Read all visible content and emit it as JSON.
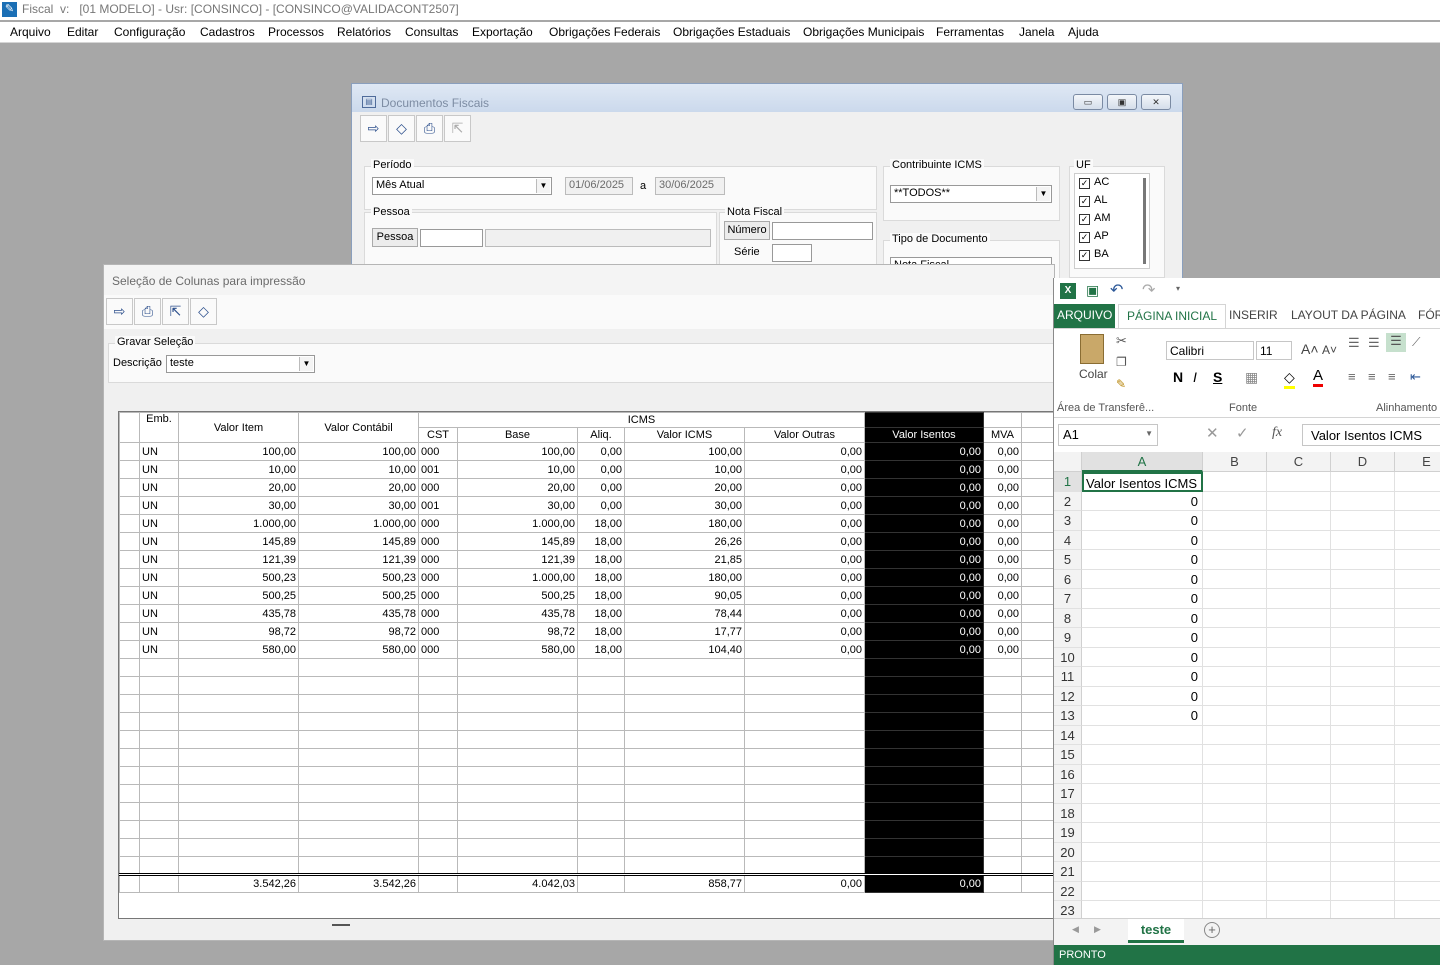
{
  "app": {
    "title": "Fiscal  v:   [01 MODELO] - Usr: [CONSINCO] - [CONSINCO@VALIDACONT2507]",
    "menu": [
      "Arquivo",
      "Editar",
      "Configuração",
      "Cadastros",
      "Processos",
      "Relatórios",
      "Consultas",
      "Exportação",
      "Obrigações Federais",
      "Obrigações Estaduais",
      "Obrigações Municipais",
      "Ferramentas",
      "Janela",
      "Ajuda"
    ]
  },
  "docwin": {
    "title": "Documentos Fiscais",
    "periodo_label": "Período",
    "periodo_value": "Mês Atual",
    "date_from": "01/06/2025",
    "date_sep": "a",
    "date_to": "30/06/2025",
    "contribuinte_label": "Contribuinte ICMS",
    "contribuinte_value": "**TODOS**",
    "uf_label": "UF",
    "uf_items": [
      "AC",
      "AL",
      "AM",
      "AP",
      "BA"
    ],
    "pessoa_label": "Pessoa",
    "pessoa_button": "Pessoa",
    "nota_label": "Nota Fiscal",
    "numero_label": "Número",
    "serie_label": "Série",
    "tipo_label": "Tipo de Documento",
    "tipo_value": "Nota Fiscal"
  },
  "selwin": {
    "title": "Seleção de Colunas para impressão",
    "gravar_label": "Gravar Seleção",
    "descricao_label": "Descrição",
    "descricao_value": "teste",
    "headers": {
      "emb": "Emb.",
      "valor_item": "Valor Item",
      "valor_contabil": "Valor Contábil",
      "icms": "ICMS",
      "cst": "CST",
      "base": "Base",
      "aliq": "Aliq.",
      "valor_icms": "Valor ICMS",
      "valor_outras": "Valor Outras",
      "valor_isentos": "Valor Isentos",
      "mva": "MVA"
    },
    "rows": [
      [
        "UN",
        "100,00",
        "100,00",
        "000",
        "100,00",
        "0,00",
        "100,00",
        "0,00",
        "0,00",
        "0,00"
      ],
      [
        "UN",
        "10,00",
        "10,00",
        "001",
        "10,00",
        "0,00",
        "10,00",
        "0,00",
        "0,00",
        "0,00"
      ],
      [
        "UN",
        "20,00",
        "20,00",
        "000",
        "20,00",
        "0,00",
        "20,00",
        "0,00",
        "0,00",
        "0,00"
      ],
      [
        "UN",
        "30,00",
        "30,00",
        "001",
        "30,00",
        "0,00",
        "30,00",
        "0,00",
        "0,00",
        "0,00"
      ],
      [
        "UN",
        "1.000,00",
        "1.000,00",
        "000",
        "1.000,00",
        "18,00",
        "180,00",
        "0,00",
        "0,00",
        "0,00"
      ],
      [
        "UN",
        "145,89",
        "145,89",
        "000",
        "145,89",
        "18,00",
        "26,26",
        "0,00",
        "0,00",
        "0,00"
      ],
      [
        "UN",
        "121,39",
        "121,39",
        "000",
        "121,39",
        "18,00",
        "21,85",
        "0,00",
        "0,00",
        "0,00"
      ],
      [
        "UN",
        "500,23",
        "500,23",
        "000",
        "1.000,00",
        "18,00",
        "180,00",
        "0,00",
        "0,00",
        "0,00"
      ],
      [
        "UN",
        "500,25",
        "500,25",
        "000",
        "500,25",
        "18,00",
        "90,05",
        "0,00",
        "0,00",
        "0,00"
      ],
      [
        "UN",
        "435,78",
        "435,78",
        "000",
        "435,78",
        "18,00",
        "78,44",
        "0,00",
        "0,00",
        "0,00"
      ],
      [
        "UN",
        "98,72",
        "98,72",
        "000",
        "98,72",
        "18,00",
        "17,77",
        "0,00",
        "0,00",
        "0,00"
      ],
      [
        "UN",
        "580,00",
        "580,00",
        "000",
        "580,00",
        "18,00",
        "104,40",
        "0,00",
        "0,00",
        "0,00"
      ]
    ],
    "totals": [
      "",
      "3.542,26",
      "3.542,26",
      "",
      "4.042,03",
      "",
      "858,77",
      "0,00",
      "0,00",
      ""
    ]
  },
  "excel": {
    "tabs": [
      "ARQUIVO",
      "PÁGINA INICIAL",
      "INSERIR",
      "LAYOUT DA PÁGINA",
      "FÓR"
    ],
    "clipboard_label": "Área de Transferê...",
    "paste_label": "Colar",
    "font_group_label": "Fonte",
    "align_group_label": "Alinhamento",
    "font_name": "Calibri",
    "font_size": "11",
    "bold": "N",
    "italic": "I",
    "underline": "S",
    "name_box": "A1",
    "formula": "Valor Isentos ICMS",
    "fx": "fx",
    "columns": [
      "A",
      "B",
      "C",
      "D",
      "E"
    ],
    "rows": [
      "1",
      "2",
      "3",
      "4",
      "5",
      "6",
      "7",
      "8",
      "9",
      "10",
      "11",
      "12",
      "13",
      "14",
      "15",
      "16",
      "17",
      "18",
      "19",
      "20",
      "21",
      "22",
      "23"
    ],
    "col_a_values": [
      "Valor Isentos ICMS",
      "0",
      "0",
      "0",
      "0",
      "0",
      "0",
      "0",
      "0",
      "0",
      "0",
      "0",
      "0"
    ],
    "sheet_tab": "teste",
    "status": "PRONTO",
    "accent": "#217346"
  }
}
